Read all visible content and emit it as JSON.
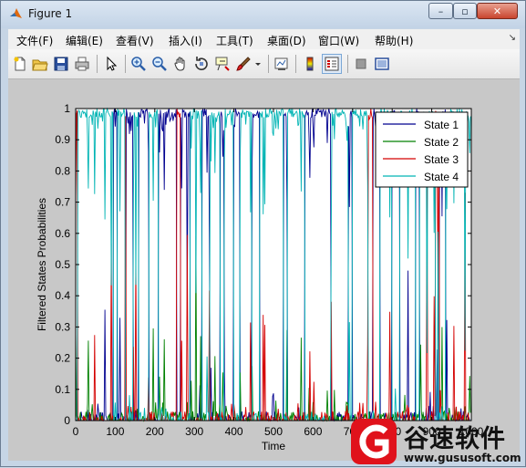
{
  "window": {
    "title": "Figure 1",
    "minimize_label": "–",
    "maximize_label": "▫",
    "close_label": "✕"
  },
  "menu": {
    "items": [
      {
        "label": "文件(F)"
      },
      {
        "label": "编辑(E)"
      },
      {
        "label": "查看(V)"
      },
      {
        "label": "插入(I)"
      },
      {
        "label": "工具(T)"
      },
      {
        "label": "桌面(D)"
      },
      {
        "label": "窗口(W)"
      },
      {
        "label": "帮助(H)"
      }
    ],
    "dock_glyph": "↘"
  },
  "toolbar": {
    "buttons": [
      {
        "icon": "new-figure-icon"
      },
      {
        "icon": "open-file-icon"
      },
      {
        "icon": "save-icon"
      },
      {
        "icon": "print-icon"
      },
      {
        "icon": "edit-plot-icon"
      },
      {
        "icon": "zoom-in-icon"
      },
      {
        "icon": "zoom-out-icon"
      },
      {
        "icon": "pan-icon"
      },
      {
        "icon": "rotate-3d-icon"
      },
      {
        "icon": "data-cursor-icon"
      },
      {
        "icon": "brush-icon"
      },
      {
        "icon": "link-plot-icon"
      },
      {
        "icon": "colorbar-icon"
      },
      {
        "icon": "legend-icon"
      },
      {
        "icon": "hide-plot-tools-icon"
      },
      {
        "icon": "show-plot-tools-icon"
      }
    ]
  },
  "chart_data": {
    "type": "line",
    "title": "",
    "xlabel": "Time",
    "ylabel": "Filtered States Probabilities",
    "xlim": [
      0,
      1000
    ],
    "ylim": [
      0,
      1
    ],
    "xticks": [
      0,
      100,
      200,
      300,
      400,
      500,
      600,
      700,
      800,
      900,
      1000
    ],
    "xtick_labels": [
      "0",
      "100",
      "200",
      "300",
      "400",
      "500",
      "600",
      "700",
      "800",
      "900",
      "1000"
    ],
    "yticks": [
      0,
      0.1,
      0.2,
      0.3,
      0.4,
      0.5,
      0.6,
      0.7,
      0.8,
      0.9,
      1
    ],
    "ytick_labels": [
      "0",
      "0.1",
      "0.2",
      "0.3",
      "0.4",
      "0.5",
      "0.6",
      "0.7",
      "0.8",
      "0.9",
      "1"
    ],
    "grid": false,
    "legend_position": "top-right",
    "series": [
      {
        "name": "State 1",
        "color": "#00008f"
      },
      {
        "name": "State 2",
        "color": "#008000"
      },
      {
        "name": "State 3",
        "color": "#d40000"
      },
      {
        "name": "State 4",
        "color": "#00b4b4"
      }
    ],
    "regimes": [
      {
        "x": [
          0,
          5
        ],
        "state": 3
      },
      {
        "x": [
          5,
          95
        ],
        "state": 4
      },
      {
        "x": [
          95,
          105
        ],
        "state": 1
      },
      {
        "x": [
          105,
          125
        ],
        "state": 4
      },
      {
        "x": [
          125,
          128
        ],
        "state": 3
      },
      {
        "x": [
          128,
          145
        ],
        "state": 1
      },
      {
        "x": [
          145,
          160
        ],
        "state": 4
      },
      {
        "x": [
          160,
          185
        ],
        "state": 1
      },
      {
        "x": [
          185,
          210
        ],
        "state": 4
      },
      {
        "x": [
          210,
          255
        ],
        "state": 1
      },
      {
        "x": [
          255,
          265
        ],
        "state": 3
      },
      {
        "x": [
          265,
          290
        ],
        "state": 1
      },
      {
        "x": [
          290,
          320
        ],
        "state": 4
      },
      {
        "x": [
          320,
          340
        ],
        "state": 1
      },
      {
        "x": [
          340,
          365
        ],
        "state": 4
      },
      {
        "x": [
          365,
          375
        ],
        "state": 1
      },
      {
        "x": [
          375,
          400
        ],
        "state": 4
      },
      {
        "x": [
          400,
          415
        ],
        "state": 1
      },
      {
        "x": [
          415,
          445
        ],
        "state": 4
      },
      {
        "x": [
          445,
          465
        ],
        "state": 1
      },
      {
        "x": [
          465,
          525
        ],
        "state": 4
      },
      {
        "x": [
          525,
          535
        ],
        "state": 1
      },
      {
        "x": [
          535,
          580
        ],
        "state": 4
      },
      {
        "x": [
          580,
          645
        ],
        "state": 1
      },
      {
        "x": [
          645,
          690
        ],
        "state": 4
      },
      {
        "x": [
          690,
          700
        ],
        "state": 1
      },
      {
        "x": [
          700,
          740
        ],
        "state": 4
      },
      {
        "x": [
          740,
          752
        ],
        "state": 3
      },
      {
        "x": [
          752,
          770
        ],
        "state": 1
      },
      {
        "x": [
          770,
          800
        ],
        "state": 4
      },
      {
        "x": [
          800,
          820
        ],
        "state": 1
      },
      {
        "x": [
          820,
          860
        ],
        "state": 4
      },
      {
        "x": [
          860,
          870
        ],
        "state": 1
      },
      {
        "x": [
          870,
          910
        ],
        "state": 4
      },
      {
        "x": [
          910,
          920
        ],
        "state": 3
      },
      {
        "x": [
          920,
          935
        ],
        "state": 1
      },
      {
        "x": [
          935,
          1000
        ],
        "state": 4
      }
    ]
  },
  "watermark": {
    "brand": "谷速软件",
    "url": "www.gususoft.com"
  }
}
